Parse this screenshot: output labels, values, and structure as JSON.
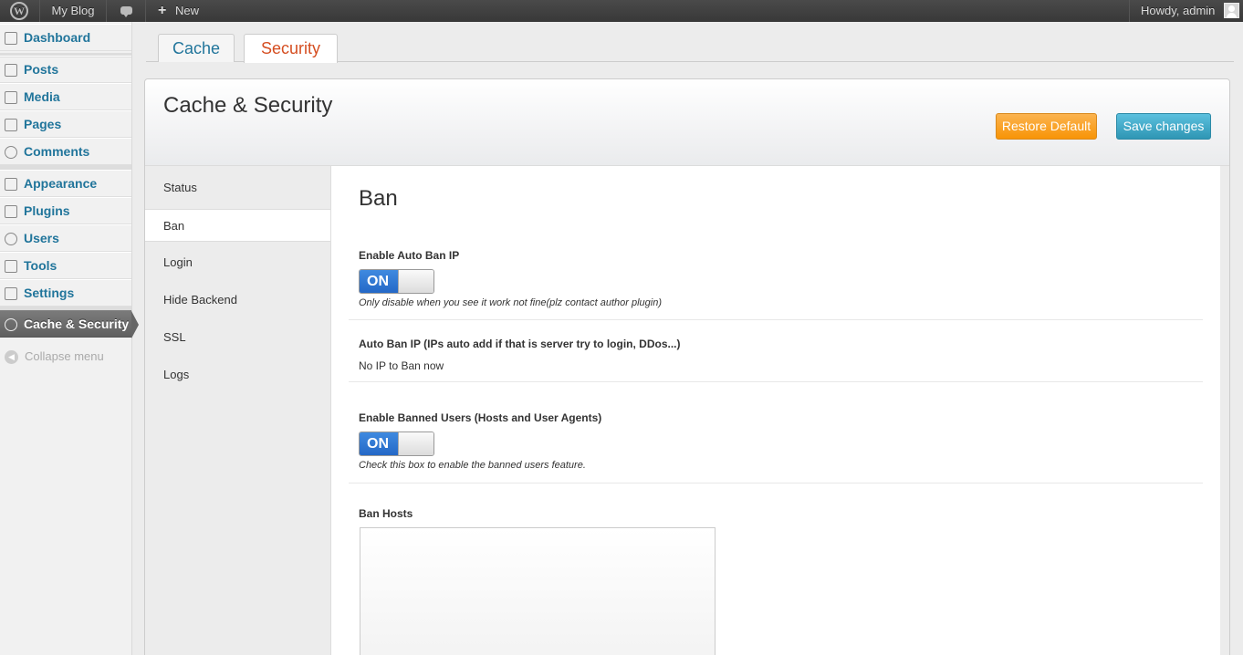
{
  "admin_bar": {
    "logo_icon": "wordpress-logo-icon",
    "site_name": "My Blog",
    "comments_icon": "comment-bubble-icon",
    "new_label": "New",
    "greeting": "Howdy, admin"
  },
  "menu": {
    "items": [
      {
        "label": "Dashboard",
        "icon": "dashboard-icon"
      },
      {
        "label": "Posts",
        "icon": "pin-icon"
      },
      {
        "label": "Media",
        "icon": "media-icon"
      },
      {
        "label": "Pages",
        "icon": "pages-icon"
      },
      {
        "label": "Comments",
        "icon": "comments-icon"
      },
      {
        "label": "Appearance",
        "icon": "appearance-icon"
      },
      {
        "label": "Plugins",
        "icon": "plug-icon"
      },
      {
        "label": "Users",
        "icon": "users-icon"
      },
      {
        "label": "Tools",
        "icon": "tools-icon"
      },
      {
        "label": "Settings",
        "icon": "settings-icon"
      },
      {
        "label": "Cache & Security",
        "icon": "gear-icon"
      }
    ],
    "collapse": "Collapse menu"
  },
  "tabs": {
    "cache": "Cache",
    "security": "Security"
  },
  "panel": {
    "title": "Cache & Security",
    "restore_label": "Restore Default",
    "save_label": "Save changes"
  },
  "subnav": [
    "Status",
    "Ban",
    "Login",
    "Hide Backend",
    "SSL",
    "Logs"
  ],
  "content": {
    "title": "Ban",
    "auto_ban": {
      "label": "Enable Auto Ban IP",
      "toggle": "ON",
      "desc": "Only disable when you see it work not fine(plz contact author plugin)"
    },
    "auto_ban_list": {
      "label": "Auto Ban IP (IPs auto add if that is server try to login, DDos...)",
      "value": "No IP to Ban now"
    },
    "banned_users": {
      "label": "Enable Banned Users (Hosts and User Agents)",
      "toggle": "ON",
      "desc": "Check this box to enable the banned users feature."
    },
    "ban_hosts": {
      "label": "Ban Hosts",
      "value": ""
    }
  },
  "colors": {
    "link": "#21759b",
    "active_tab": "#d54e21",
    "restore_button": "#f89406",
    "save_button": "#2f96b4",
    "toggle_on": "#2468c7"
  }
}
